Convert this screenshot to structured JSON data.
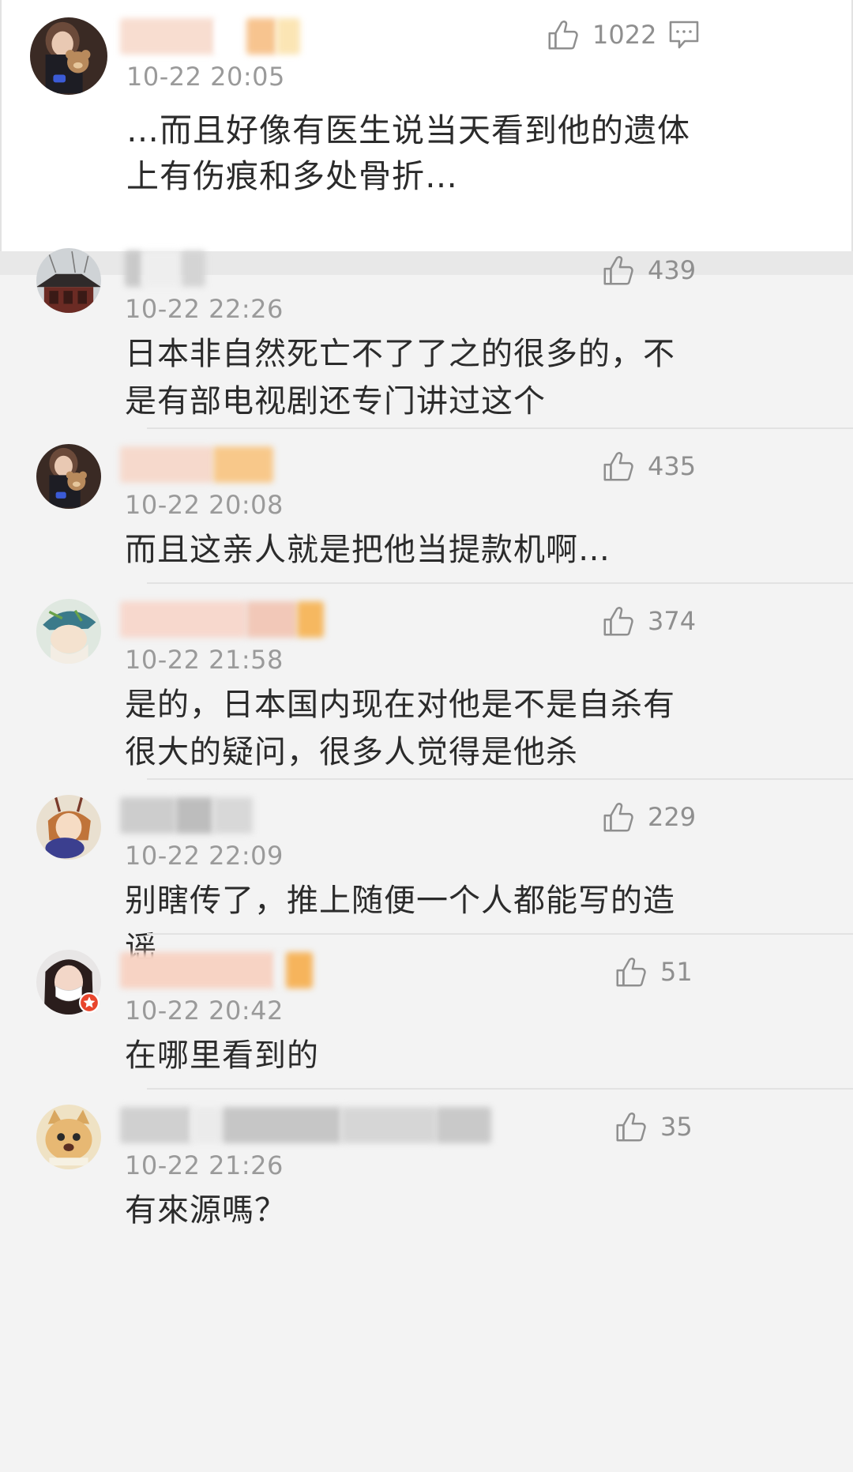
{
  "main_comment": {
    "username": "",
    "time": "10-22 20:05",
    "likes": "1022",
    "text": "…而且好像有医生说当天看到他的遗体上有伤痕和多处骨折…",
    "avatar_icon": "avatar-girl-with-bear"
  },
  "replies": [
    {
      "time": "10-22 22:26",
      "likes": "439",
      "text": "日本非自然死亡不了了之的很多的，不是有部电视剧还专门讲过这个",
      "avatar_icon": "avatar-temple-roof"
    },
    {
      "time": "10-22 20:08",
      "likes": "435",
      "text": "而且这亲人就是把他当提款机啊…",
      "avatar_icon": "avatar-girl-with-bear"
    },
    {
      "time": "10-22 21:58",
      "likes": "374",
      "text": "是的，日本国内现在对他是不是自杀有很大的疑问，很多人觉得是他杀",
      "avatar_icon": "avatar-anime-hat"
    },
    {
      "time": "10-22 22:09",
      "likes": "229",
      "text": "别瞎传了，推上随便一个人都能写的造谣",
      "avatar_icon": "avatar-anime-character"
    },
    {
      "time": "10-22 20:42",
      "likes": "51",
      "text": "在哪里看到的",
      "avatar_icon": "avatar-girl-mask"
    },
    {
      "time": "10-22 21:26",
      "likes": "35",
      "text": "有來源嗎？",
      "avatar_icon": "avatar-cat"
    }
  ],
  "colors": {
    "text": "#2b2b2b",
    "meta": "#9a9a9a",
    "background": "#f3f3f3",
    "card": "#ffffff",
    "name_highlight": "#f5b24a",
    "verified_badge": "#e8452c"
  }
}
